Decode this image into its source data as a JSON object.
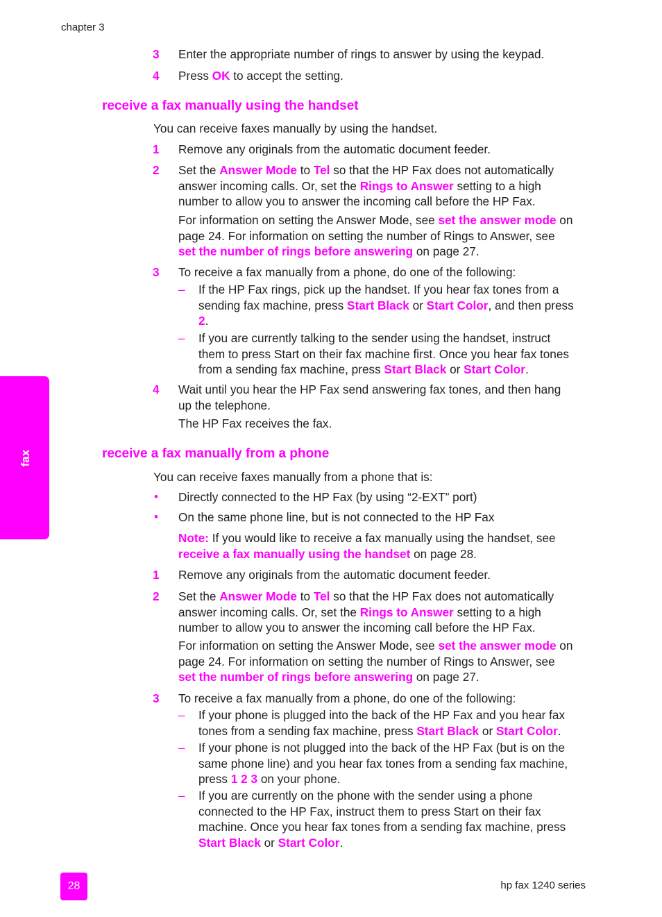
{
  "header": {
    "chapter": "chapter 3"
  },
  "side_tab": {
    "label": "fax"
  },
  "accent_color": "#ff00ff",
  "intro_steps": [
    {
      "num": "3",
      "text": "Enter the appropriate number of rings to answer by using the keypad."
    },
    {
      "num": "4",
      "pre": "Press ",
      "key": "OK",
      "post": " to accept the setting."
    }
  ],
  "section1": {
    "title": "receive a fax manually using the handset",
    "intro": "You can receive faxes manually by using the handset.",
    "s1": {
      "num": "1",
      "text": "Remove any originals from the automatic document feeder."
    },
    "s2": {
      "num": "2",
      "a": "Set the ",
      "k1": "Answer Mode",
      "b": " to ",
      "k2": "Tel",
      "c": " so that the HP Fax does not automatically",
      "d": "answer incoming calls. Or, set the ",
      "k3": "Rings to Answer",
      "e": " setting to a high",
      "f": "number to allow you to answer the incoming call before the HP Fax.",
      "g": "For information on setting the Answer Mode, see ",
      "l1": "set the answer mode",
      "h": " on",
      "i": "page 24. For information on setting the number of Rings to Answer, see",
      "l2": "set the number of rings before answering",
      "j": " on page 27."
    },
    "s3": {
      "num": "3",
      "text": "To receive a fax manually from a phone, do one of the following:",
      "dash": "–",
      "d1": {
        "a": "If the HP Fax rings, pick up the handset. If you hear fax tones from a",
        "b": "sending fax machine, press ",
        "k1": "Start Black",
        "c": " or ",
        "k2": "Start Color",
        "d": ", and then press",
        "k3": "2",
        "e": "."
      },
      "d2": {
        "a": "If you are currently talking to the sender using the handset, instruct",
        "b": "them to press Start on their fax machine first. Once you hear fax tones",
        "c": "from a sending fax machine, press ",
        "k1": "Start Black",
        "d": " or ",
        "k2": "Start Color",
        "e": "."
      }
    },
    "s4": {
      "num": "4",
      "a": "Wait until you hear the HP Fax send answering fax tones, and then hang",
      "b": "up the telephone.",
      "c": "The HP Fax receives the fax."
    }
  },
  "section2": {
    "title": "receive a fax manually from a phone",
    "intro": "You can receive faxes manually from a phone that is:",
    "bullet": "•",
    "bullets": [
      "Directly connected to the HP Fax (by using “2-EXT” port)",
      "On the same phone line, but is not connected to the HP Fax"
    ],
    "note": {
      "label": "Note:",
      "a": "  If you would like to receive a fax manually using the handset, see",
      "link": "receive a fax manually using the handset",
      "b": " on page 28."
    },
    "s1": {
      "num": "1",
      "text": "Remove any originals from the automatic document feeder."
    },
    "s2": {
      "num": "2",
      "a": "Set the ",
      "k1": "Answer Mode",
      "b": " to ",
      "k2": "Tel",
      "c": " so that the HP Fax does not automatically",
      "d": "answer incoming calls. Or, set the ",
      "k3": "Rings to Answer",
      "e": " setting to a high",
      "f": "number to allow you to answer the incoming call before the HP Fax.",
      "g": "For information on setting the Answer Mode, see ",
      "l1": "set the answer mode",
      "h": " on",
      "i": "page 24. For information on setting the number of Rings to Answer, see",
      "l2": "set the number of rings before answering",
      "j": " on page 27."
    },
    "s3": {
      "num": "3",
      "text": "To receive a fax manually from a phone, do one of the following:",
      "dash": "–",
      "d1": {
        "a": "If your phone is plugged into the back of the HP Fax and you hear fax",
        "b": "tones from a sending fax machine, press ",
        "k1": "Start Black",
        "c": " or ",
        "k2": "Start Color",
        "d": "."
      },
      "d2": {
        "a": "If your phone is not plugged into the back of the HP Fax (but is on the",
        "b": "same phone line) and you hear fax tones from a sending fax machine,",
        "c": "press ",
        "k1": "1 2 3",
        "d": " on your phone."
      },
      "d3": {
        "a": "If you are currently on the phone with the sender using a phone",
        "b": "connected to the HP Fax, instruct them to press Start on their fax",
        "c": "machine. Once you hear fax tones from a sending fax machine, press",
        "k1": "Start Black",
        "d": " or ",
        "k2": "Start Color",
        "e": "."
      }
    }
  },
  "footer": {
    "page_number": "28",
    "series": "hp fax 1240 series"
  }
}
